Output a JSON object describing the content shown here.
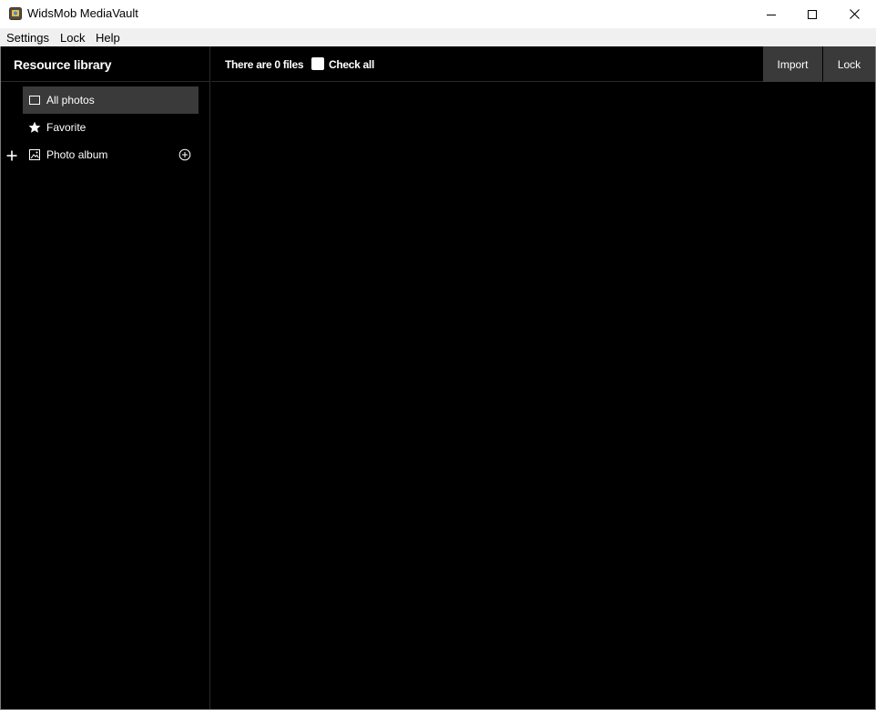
{
  "window": {
    "title": "WidsMob MediaVault",
    "icon": "mediavault-app-icon"
  },
  "menu": {
    "items": [
      "Settings",
      "Lock",
      "Help"
    ]
  },
  "sidebar": {
    "title": "Resource library",
    "items": [
      {
        "label": "All photos",
        "icon": "square-icon",
        "active": true
      },
      {
        "label": "Favorite",
        "icon": "star-icon",
        "active": false
      },
      {
        "label": "Photo album",
        "icon": "image-icon",
        "active": false
      }
    ]
  },
  "toolbar": {
    "file_count": "There are 0 files",
    "check_all": "Check all",
    "import_label": "Import",
    "lock_label": "Lock"
  },
  "colors": {
    "background": "#000000",
    "active_item": "#3a3a3a",
    "button": "#3a3a3a",
    "text": "#ffffff"
  }
}
